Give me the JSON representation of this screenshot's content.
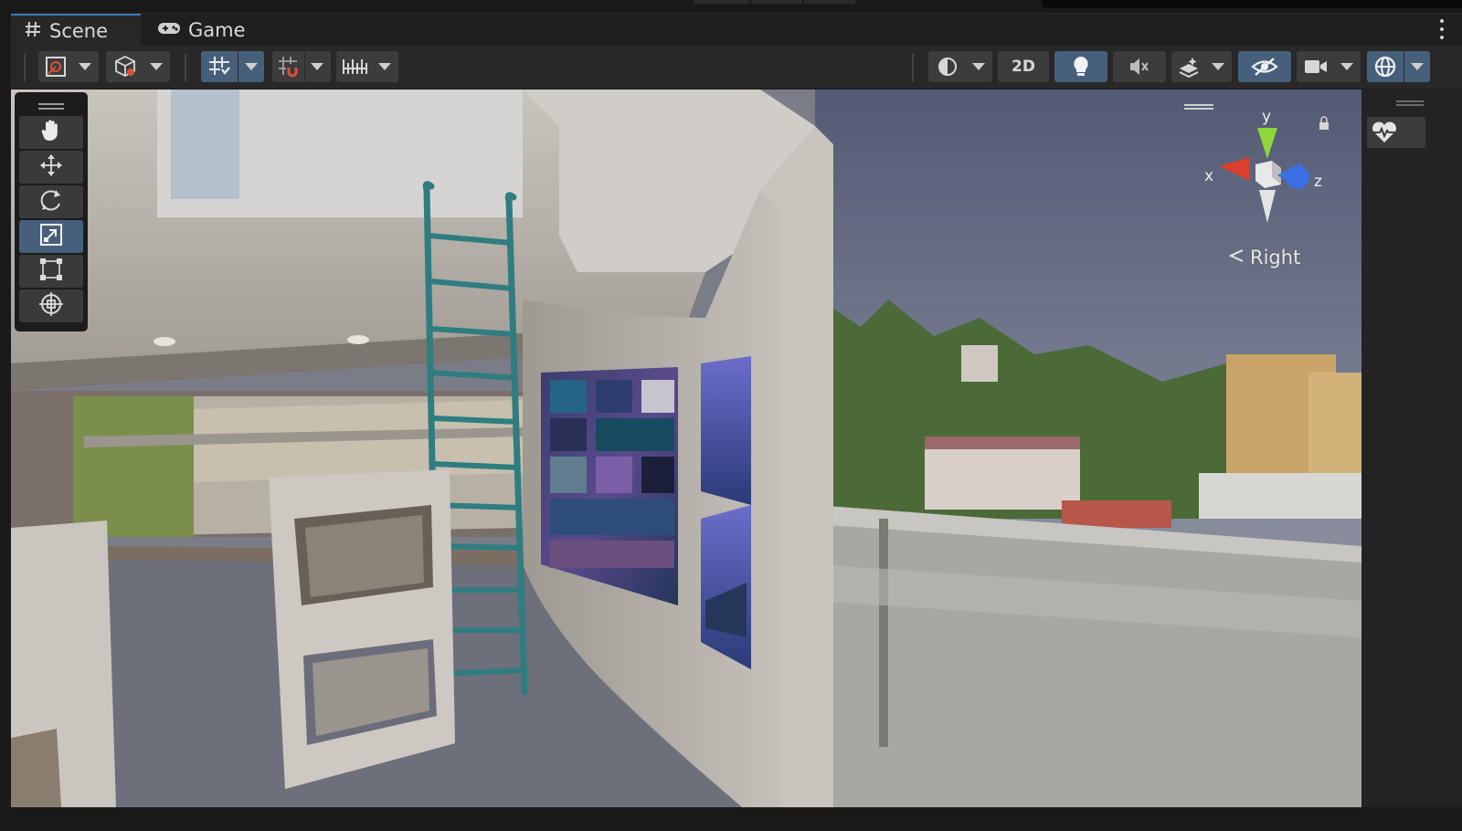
{
  "tabs": [
    {
      "label": "Scene",
      "icon": "grid-hash-icon",
      "active": true
    },
    {
      "label": "Game",
      "icon": "gamepad-icon",
      "active": false
    }
  ],
  "toolbar": {
    "toggle_2d_label": "2D"
  },
  "tools": [
    "hand-tool",
    "move-tool",
    "rotate-tool",
    "scale-tool",
    "rect-tool",
    "transform-tool"
  ],
  "selected_tool": "scale-tool",
  "gizmo": {
    "axis_y": "y",
    "axis_x": "x",
    "axis_z": "z",
    "view_label": "Right"
  },
  "colors": {
    "accent_active": "#46607c",
    "tab_underline": "#3a79bb",
    "axis_x": "#d9402d",
    "axis_y": "#8fd63b",
    "axis_z": "#3b6fe3",
    "ladder": "#2f7d80"
  }
}
